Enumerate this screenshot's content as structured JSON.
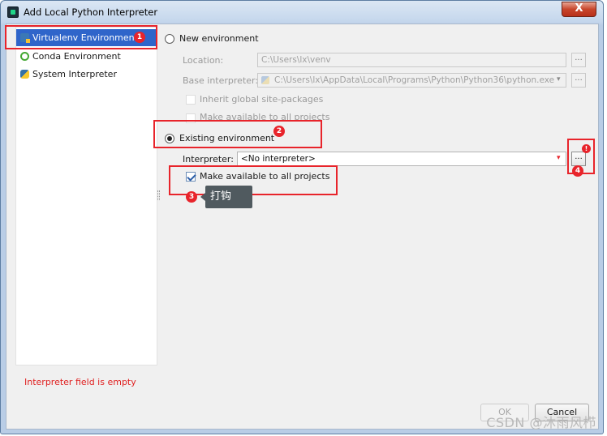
{
  "window": {
    "title": "Add Local Python Interpreter",
    "close_glyph": "X"
  },
  "sidebar": {
    "items": [
      {
        "label": "Virtualenv Environment",
        "icon": "virtualenv-icon"
      },
      {
        "label": "Conda Environment",
        "icon": "conda-icon"
      },
      {
        "label": "System Interpreter",
        "icon": "python-icon"
      }
    ]
  },
  "new_env": {
    "radio_label": "New environment",
    "location_label": "Location:",
    "location_value": "C:\\Users\\lx\\venv",
    "base_label": "Base interpreter:",
    "base_value": "C:\\Users\\lx\\AppData\\Local\\Programs\\Python\\Python36\\python.exe",
    "inherit_label": "Inherit global site-packages",
    "make_available_label": "Make available to all projects"
  },
  "existing_env": {
    "radio_label": "Existing environment",
    "interpreter_label": "Interpreter:",
    "interpreter_value": "<No interpreter>",
    "make_available_label": "Make available to all projects"
  },
  "browse_glyph": "...",
  "dropdown_glyph": "▾",
  "warning_glyph": "!",
  "annotations": {
    "badges": [
      "1",
      "2",
      "3",
      "4"
    ],
    "tooltip": "打钩",
    "color": "#e8242b"
  },
  "error_message": "Interpreter field is empty",
  "buttons": {
    "ok": "OK",
    "cancel": "Cancel"
  },
  "watermark": "CSDN @沐雨风栉"
}
